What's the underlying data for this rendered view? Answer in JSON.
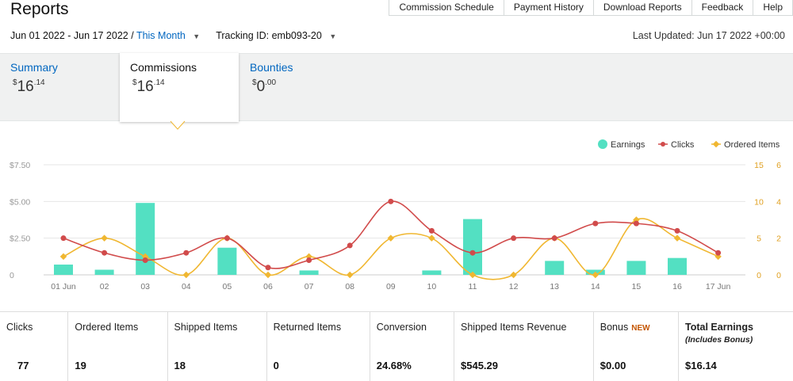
{
  "title": "Reports",
  "top_nav": [
    "Commission Schedule",
    "Payment History",
    "Download Reports",
    "Feedback",
    "Help"
  ],
  "filters": {
    "date_range": "Jun 01 2022 - Jun 17 2022 /",
    "period": "This Month",
    "tracking_label": "Tracking ID:",
    "tracking_id": "emb093-20"
  },
  "last_updated": "Last Updated: Jun 17 2022 +00:00",
  "summary_tabs": [
    {
      "label": "Summary",
      "dollar": "$",
      "whole": "16",
      "cents": ".14"
    },
    {
      "label": "Commissions",
      "dollar": "$",
      "whole": "16",
      "cents": ".14"
    },
    {
      "label": "Bounties",
      "dollar": "$",
      "whole": "0",
      "cents": ".00"
    }
  ],
  "colors": {
    "earnings": "#53e0c2",
    "clicks": "#d14b4b",
    "ordered": "#f0b731",
    "link": "#0066c0"
  },
  "chart_data": {
    "type": "bar",
    "categories": [
      "01 Jun",
      "02",
      "03",
      "04",
      "05",
      "06",
      "07",
      "08",
      "09",
      "10",
      "11",
      "12",
      "13",
      "14",
      "15",
      "16",
      "17 Jun"
    ],
    "left_axis_ticks": [
      "$7.50",
      "$5.00",
      "$2.50",
      "0"
    ],
    "left_ylim": [
      0,
      7.5
    ],
    "right_axis_ticks_1": [
      "15",
      "10",
      "5",
      "0"
    ],
    "right_axis_ticks_2": [
      "6",
      "4",
      "2",
      "0"
    ],
    "legend": [
      "Earnings",
      "Clicks",
      "Ordered Items"
    ],
    "legend_position": "top-right",
    "series": [
      {
        "name": "Earnings",
        "type": "bar",
        "axis": "dollars",
        "values": [
          0.7,
          0.35,
          4.9,
          0,
          1.85,
          0,
          0.3,
          0,
          0,
          0.3,
          3.8,
          0,
          0.95,
          0.35,
          0.95,
          1.15,
          0
        ]
      },
      {
        "name": "Clicks",
        "type": "line",
        "axis": "0-15",
        "values": [
          5,
          3,
          2,
          3,
          5,
          1,
          2,
          4,
          10,
          6,
          3,
          5,
          5,
          7,
          7,
          6,
          3
        ]
      },
      {
        "name": "Ordered Items",
        "type": "line",
        "axis": "0-6",
        "values": [
          1,
          2,
          1,
          0,
          2,
          0,
          1,
          0,
          2,
          2,
          0,
          0,
          2,
          0,
          3,
          2,
          1
        ]
      }
    ]
  },
  "stats": [
    {
      "label": "Clicks",
      "value": "77"
    },
    {
      "label": "Ordered Items",
      "value": "19"
    },
    {
      "label": "Shipped Items",
      "value": "18"
    },
    {
      "label": "Returned Items",
      "value": "0"
    },
    {
      "label": "Conversion",
      "value": "24.68%"
    },
    {
      "label": "Shipped Items Revenue",
      "value": "$545.29"
    },
    {
      "label": "Bonus",
      "badge": "NEW",
      "value": "$0.00"
    },
    {
      "label": "Total Earnings",
      "note": "(Includes Bonus)",
      "value": "$16.14"
    }
  ]
}
